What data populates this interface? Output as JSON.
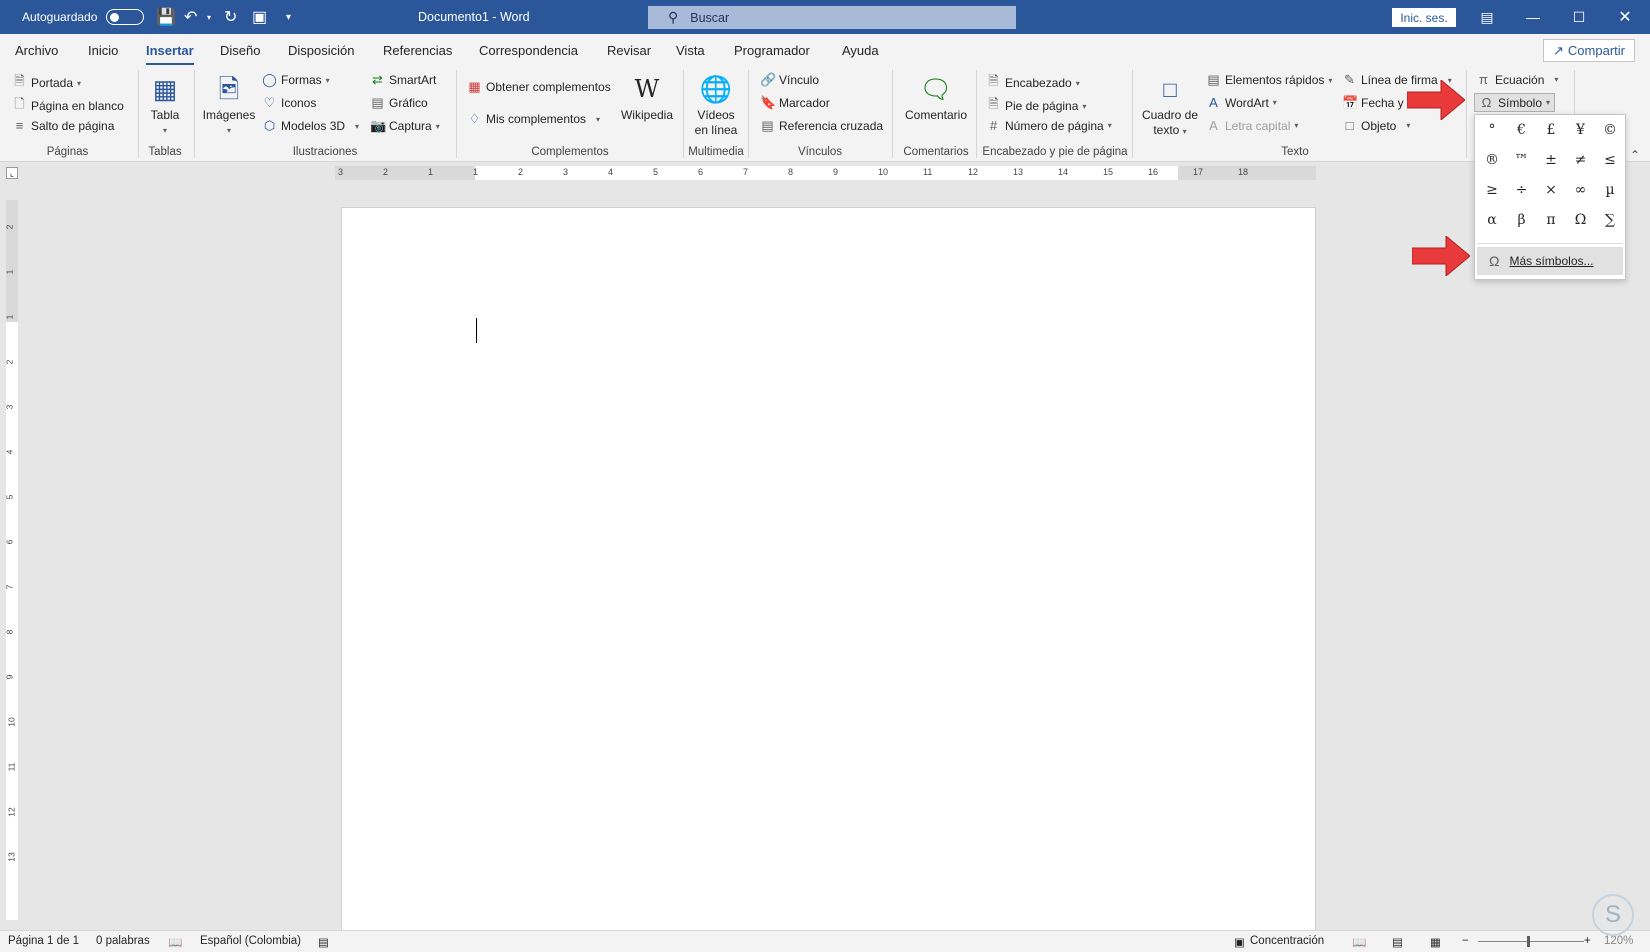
{
  "titlebar": {
    "autosave_label": "Autoguardado",
    "doc_title": "Documento1  -  Word",
    "search_placeholder": "Buscar",
    "signin_label": "Inic. ses.",
    "icons": [
      "save-icon",
      "undo-icon",
      "redo-icon",
      "touch-mode-icon",
      "customize-qat-icon"
    ]
  },
  "tabs": [
    "Archivo",
    "Inicio",
    "Insertar",
    "Diseño",
    "Disposición",
    "Referencias",
    "Correspondencia",
    "Revisar",
    "Vista",
    "Programador",
    "Ayuda"
  ],
  "active_tab": "Insertar",
  "share_label": "Compartir",
  "ribbon": {
    "paginas": {
      "portada": "Portada",
      "pagina_blanco": "Página en blanco",
      "salto": "Salto de página",
      "group": "Páginas"
    },
    "tablas": {
      "tabla": "Tabla",
      "group": "Tablas"
    },
    "ilustraciones": {
      "imagenes": "Imágenes",
      "formas": "Formas",
      "iconos": "Iconos",
      "modelos3d": "Modelos 3D",
      "smartart": "SmartArt",
      "grafico": "Gráfico",
      "captura": "Captura",
      "group": "Ilustraciones"
    },
    "complementos": {
      "obtener": "Obtener complementos",
      "mis": "Mis complementos",
      "wikipedia": "Wikipedia",
      "group": "Complementos"
    },
    "multimedia": {
      "videos_1": "Vídeos",
      "videos_2": "en línea",
      "group": "Multimedia"
    },
    "vinculos": {
      "vinculo": "Vínculo",
      "marcador": "Marcador",
      "referencia": "Referencia cruzada",
      "group": "Vínculos"
    },
    "comentarios": {
      "comentario": "Comentario",
      "group": "Comentarios"
    },
    "encabezado": {
      "encabezado": "Encabezado",
      "pie": "Pie de página",
      "numero": "Número de página",
      "group": "Encabezado y pie de página"
    },
    "texto": {
      "cuadro_1": "Cuadro de",
      "cuadro_2": "texto",
      "elementos": "Elementos rápidos",
      "wordart": "WordArt",
      "letra": "Letra capital",
      "linea": "Línea de firma",
      "fecha": "Fecha y hora",
      "objeto": "Objeto",
      "group": "Texto"
    },
    "simbolos": {
      "ecuacion": "Ecuación",
      "simbolo": "Símbolo"
    }
  },
  "symbol_dropdown": {
    "symbols": [
      "°",
      "€",
      "£",
      "¥",
      "©",
      "®",
      "™",
      "±",
      "≠",
      "≤",
      "≥",
      "÷",
      "×",
      "∞",
      "µ",
      "α",
      "β",
      "π",
      "Ω",
      "∑"
    ],
    "more_label": "Más símbolos..."
  },
  "ruler": {
    "h_numbers": [
      "3",
      "2",
      "1",
      "1",
      "2",
      "3",
      "4",
      "5",
      "6",
      "7",
      "8",
      "9",
      "10",
      "11",
      "12",
      "13",
      "14",
      "15",
      "16",
      "17",
      "18"
    ],
    "v_numbers": [
      "2",
      "1",
      "1",
      "2",
      "3",
      "4",
      "5",
      "6",
      "7",
      "8",
      "9",
      "10",
      "11",
      "12",
      "13"
    ]
  },
  "status": {
    "page": "Página 1 de 1",
    "words": "0 palabras",
    "language": "Español (Colombia)",
    "focus": "Concentración",
    "zoom": "120%"
  },
  "colors": {
    "brand": "#2b579a",
    "arrow": "#e83a3a"
  }
}
